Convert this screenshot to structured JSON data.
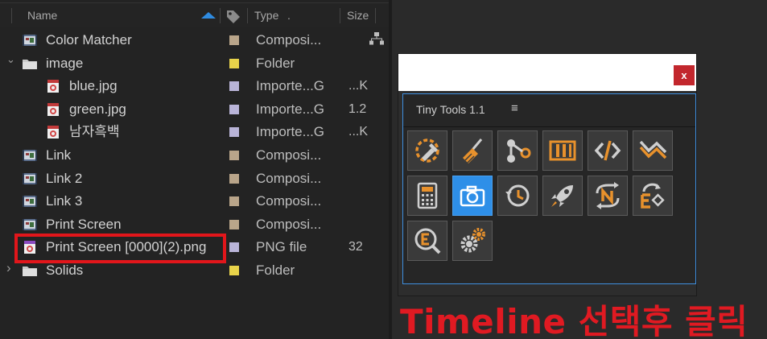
{
  "project": {
    "columns": {
      "name": "Name",
      "type": "Type",
      "type_dots": ".",
      "size": "Size"
    },
    "rows": [
      {
        "name": "Color Matcher",
        "type": "Composi...",
        "size": "",
        "kind": "comp",
        "swatch": "#b9a58a",
        "indent": 0
      },
      {
        "name": "image",
        "type": "Folder",
        "size": "",
        "kind": "folder",
        "swatch": "#e8d34a",
        "indent": 0,
        "twirl": "open"
      },
      {
        "name": "blue.jpg",
        "type": "Importe...G",
        "size": "...K",
        "kind": "image",
        "swatch": "#b9b4d8",
        "indent": 1
      },
      {
        "name": "green.jpg",
        "type": "Importe...G",
        "size": "1.2",
        "kind": "image",
        "swatch": "#b9b4d8",
        "indent": 1
      },
      {
        "name": "남자흑백",
        "type": "Importe...G",
        "size": "...K",
        "kind": "image",
        "swatch": "#b9b4d8",
        "indent": 1
      },
      {
        "name": "Link",
        "type": "Composi...",
        "size": "",
        "kind": "comp",
        "swatch": "#b9a58a",
        "indent": 0
      },
      {
        "name": "Link 2",
        "type": "Composi...",
        "size": "",
        "kind": "comp",
        "swatch": "#b9a58a",
        "indent": 0
      },
      {
        "name": "Link 3",
        "type": "Composi...",
        "size": "",
        "kind": "comp",
        "swatch": "#b9a58a",
        "indent": 0
      },
      {
        "name": "Print Screen",
        "type": "Composi...",
        "size": "",
        "kind": "comp",
        "swatch": "#b9a58a",
        "indent": 0
      },
      {
        "name": "Print Screen [0000](2).png",
        "type": "PNG file",
        "size": "32",
        "kind": "png",
        "swatch": "#b9b4d8",
        "indent": 0
      },
      {
        "name": "Solids",
        "type": "Folder",
        "size": "",
        "kind": "folder",
        "swatch": "#e8d34a",
        "indent": 0,
        "twirl": "closed"
      }
    ]
  },
  "tiny_tools": {
    "close_label": "x",
    "title": "Tiny Tools 1.1",
    "menu_icon": "≡",
    "tools": [
      {
        "icon": "color-picker-icon",
        "active": false
      },
      {
        "icon": "broom-icon",
        "active": false
      },
      {
        "icon": "nodes-icon",
        "active": false
      },
      {
        "icon": "film-strip-icon",
        "active": false
      },
      {
        "icon": "code-icon",
        "active": false
      },
      {
        "icon": "zigzag-icon",
        "active": false
      },
      {
        "icon": "calculator-icon",
        "active": false
      },
      {
        "icon": "camera-icon",
        "active": true
      },
      {
        "icon": "history-icon",
        "active": false
      },
      {
        "icon": "rocket-icon",
        "active": false
      },
      {
        "icon": "loop-n-icon",
        "active": false
      },
      {
        "icon": "expression-icon",
        "active": false
      },
      {
        "icon": "search-expression-icon",
        "active": false
      },
      {
        "icon": "gears-icon",
        "active": false
      }
    ]
  },
  "caption": "Timeline 선택후 클릭",
  "colors": {
    "accent": "#2e8fe8",
    "highlight": "#e2161b",
    "caption": "#e01a22",
    "tool_orange": "#e8912c"
  }
}
